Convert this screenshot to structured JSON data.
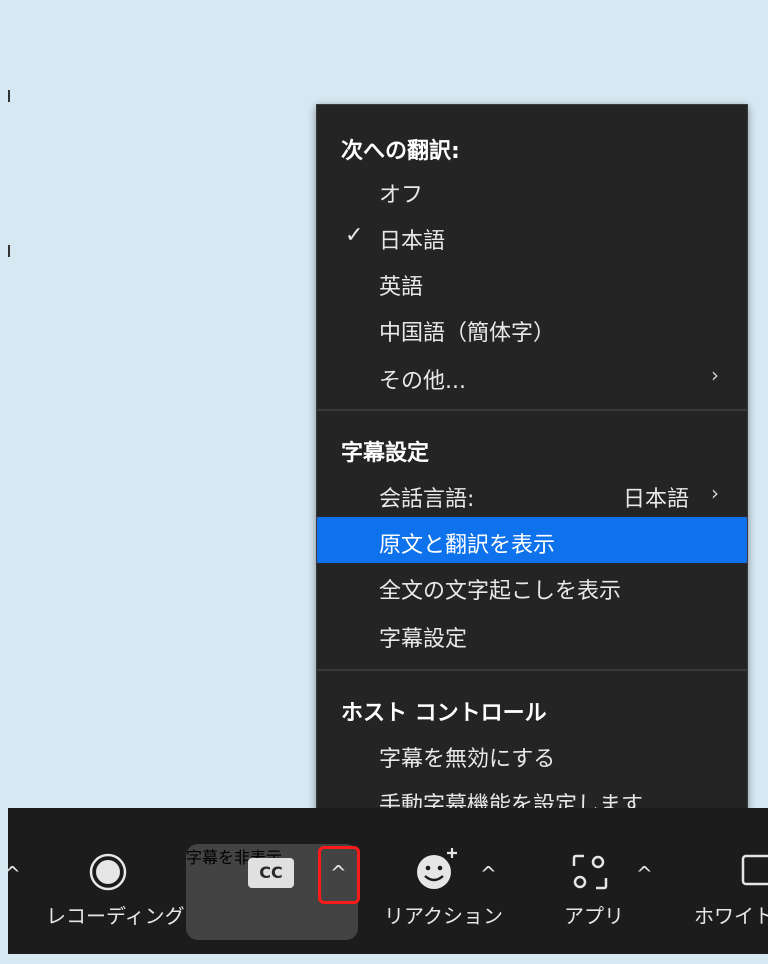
{
  "menu": {
    "translation_header": "次への翻訳:",
    "translation_items": [
      {
        "label": "オフ",
        "checked": false
      },
      {
        "label": "日本語",
        "checked": true
      },
      {
        "label": "英語",
        "checked": false
      },
      {
        "label": "中国語（簡体字）",
        "checked": false
      },
      {
        "label": "その他...",
        "checked": false,
        "submenu": true
      }
    ],
    "caption_header": "字幕設定",
    "spoken_language_label": "会話言語:",
    "spoken_language_value": "日本語",
    "show_original_translation": "原文と翻訳を表示",
    "show_full_transcript": "全文の文字起こしを表示",
    "caption_settings": "字幕設定",
    "host_header": "ホスト コントロール",
    "disable_captions": "字幕を無効にする",
    "manual_captions": "手動字幕機能を設定します..."
  },
  "toolbar": {
    "recording_label": "レコーディング",
    "cc_badge": "CC",
    "hide_captions_label": "字幕を非表示",
    "reactions_label": "リアクション",
    "apps_label": "アプリ",
    "whiteboard_label": "ホワイト"
  },
  "colors": {
    "highlight": "#0e72ed",
    "menu_bg": "#242424",
    "caret_outline": "#ff1a1a"
  }
}
